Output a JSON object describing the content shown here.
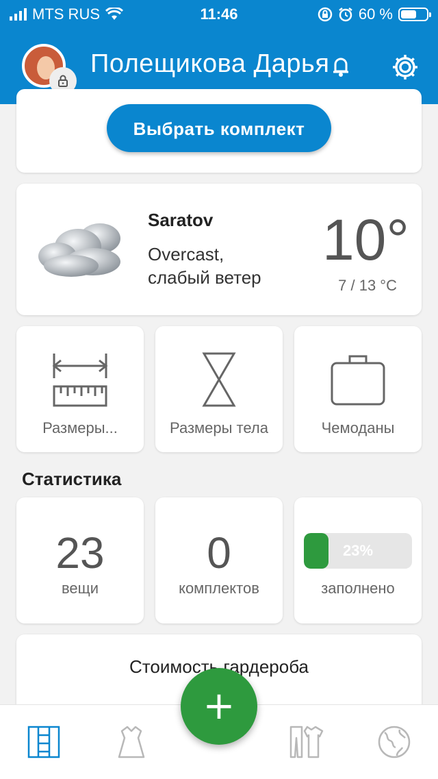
{
  "status_bar": {
    "carrier": "MTS RUS",
    "time": "11:46",
    "battery_percent": "60 %",
    "battery_level": 0.6
  },
  "header": {
    "user_name": "Полещикова Дарья"
  },
  "outfit": {
    "choose_button": "Выбрать комплект"
  },
  "weather": {
    "city": "Saratov",
    "description": "Overcast, слабый ветер",
    "temperature": "10°",
    "range": "7 / 13 °C"
  },
  "tiles": [
    {
      "label": "Размеры...",
      "icon": "ruler-icon"
    },
    {
      "label": "Размеры тела",
      "icon": "hourglass-body-icon"
    },
    {
      "label": "Чемоданы",
      "icon": "suitcase-icon"
    }
  ],
  "statistics": {
    "title": "Статистика",
    "items_count": "23",
    "items_label": "вещи",
    "outfits_count": "0",
    "outfits_label": "комплектов",
    "filled_percent": "23%",
    "filled_fraction": 0.23,
    "filled_label": "заполнено"
  },
  "wardrobe_cost": {
    "title": "Стоимость гардероба"
  },
  "bottom_nav": {
    "items": [
      "wardrobe-icon",
      "dress-icon",
      "clothes-set-icon",
      "globe-icon"
    ],
    "fab_label": "+",
    "active_color": "#0a86cf",
    "inactive_color": "#b8b8b8"
  },
  "colors": {
    "primary": "#0a86cf",
    "accent_green": "#2e9a3e"
  }
}
